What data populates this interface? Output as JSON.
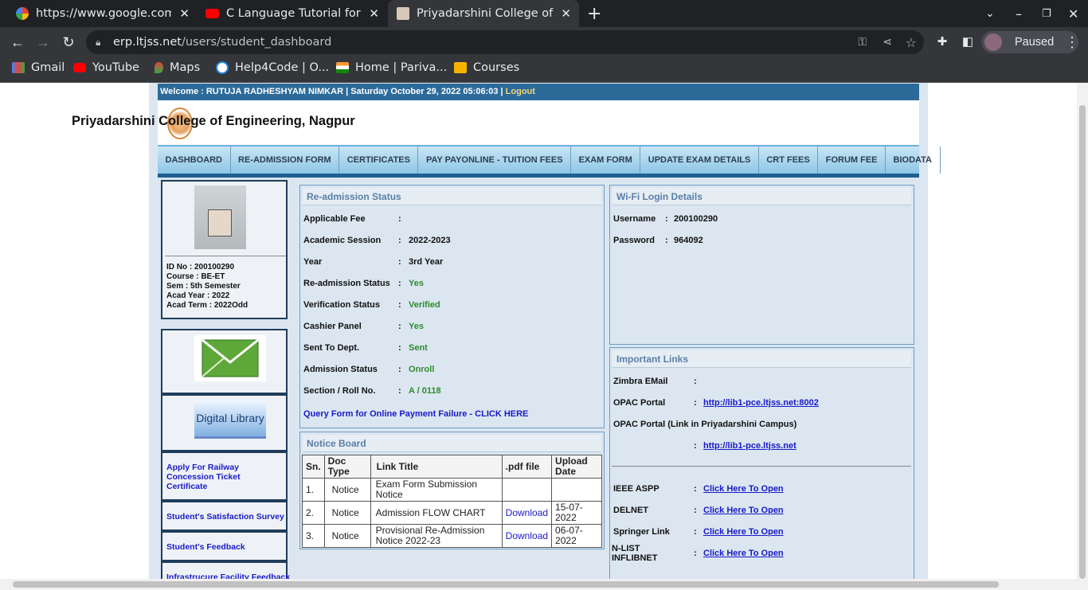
{
  "browser": {
    "tabs": [
      {
        "title": "https://www.google.com",
        "close": "✕"
      },
      {
        "title": "C Language Tutorial for B",
        "close": "✕"
      },
      {
        "title": "Priyadarshini College of E",
        "close": "✕"
      }
    ],
    "new_tab": "+",
    "address": {
      "host": "erp.ltjss.net",
      "path": "/users/student_dashboard"
    },
    "profile": "Paused",
    "bookmarks": [
      "Gmail",
      "YouTube",
      "Maps",
      "Help4Code | O...",
      "Home | Pariva...",
      "Courses"
    ]
  },
  "page": {
    "welcome": "Welcome : RUTUJA RADHESHYAM NIMKAR | Saturday October 29, 2022 05:06:03 |",
    "logout": "Logout",
    "college": "Priyadarshini College of Engineering, Nagpur",
    "menu": [
      "DASHBOARD",
      "RE-ADMISSION FORM",
      "CERTIFICATES",
      "PAY PAYONLINE - TUITION FEES",
      "EXAM FORM",
      "UPDATE EXAM DETAILS",
      "CRT FEES",
      "FORUM FEE",
      "BIODATA"
    ],
    "student": {
      "id": "ID No  : 200100290",
      "course": "Course  : BE-ET",
      "sem": "Sem   : 5th Semester",
      "acad_year": "Acad Year : 2022",
      "acad_term": "Acad Term : 2022Odd"
    },
    "digital_library": "Digital Library",
    "side_links": [
      "Apply For Railway Concession Ticket Certificate",
      "Student's Satisfaction Survey",
      "Student's Feedback",
      "Infrastrucure Facility Feedback"
    ],
    "readmission": {
      "title": "Re-admission Status",
      "rows": [
        {
          "label": "Applicable Fee",
          "value": ""
        },
        {
          "label": "Academic Session",
          "value": "2022-2023"
        },
        {
          "label": "Year",
          "value": "3rd Year"
        },
        {
          "label": "Re-admission Status",
          "value": "Yes"
        },
        {
          "label": "Verification Status",
          "value": "Verified"
        },
        {
          "label": "Cashier Panel",
          "value": "Yes"
        },
        {
          "label": "Sent To Dept.",
          "value": "Sent"
        },
        {
          "label": "Admission Status",
          "value": "Onroll"
        },
        {
          "label": "Section / Roll No.",
          "value": "A / 0118"
        }
      ],
      "query": "Query Form for Online Payment Failure - CLICK HERE"
    },
    "notice": {
      "title": "Notice Board",
      "headers": [
        "Sn.",
        "Doc Type",
        "Link Title",
        ".pdf file",
        "Upload Date"
      ],
      "rows": [
        [
          "1.",
          "Notice",
          "Exam Form Submission Notice",
          "",
          ""
        ],
        [
          "2.",
          "Notice",
          "Admission FLOW CHART",
          "Download",
          "15-07-2022"
        ],
        [
          "3.",
          "Notice",
          "Provisional Re-Admission Notice 2022-23",
          "Download",
          "06-07-2022"
        ]
      ]
    },
    "wifi": {
      "title": "Wi-Fi Login Details",
      "username_label": "Username",
      "username": "200100290",
      "password_label": "Password",
      "password": "964092"
    },
    "links": {
      "title": "Important Links",
      "zimbra": "Zimbra EMail",
      "opac": "OPAC Portal",
      "opac_url": "http://lib1-pce.ltjss.net:8002",
      "opac_campus": "OPAC Portal (Link in Priyadarshini Campus)",
      "opac_campus_url": "http://lib1-pce.ltjss.net",
      "items": [
        {
          "label": "IEEE ASPP",
          "link": "Click Here To Open"
        },
        {
          "label": "DELNET",
          "link": "Click Here To Open"
        },
        {
          "label": "Springer Link",
          "link": "Click Here To Open"
        },
        {
          "label": "N-LIST INFLIBNET",
          "link": "Click Here To Open"
        }
      ]
    }
  }
}
